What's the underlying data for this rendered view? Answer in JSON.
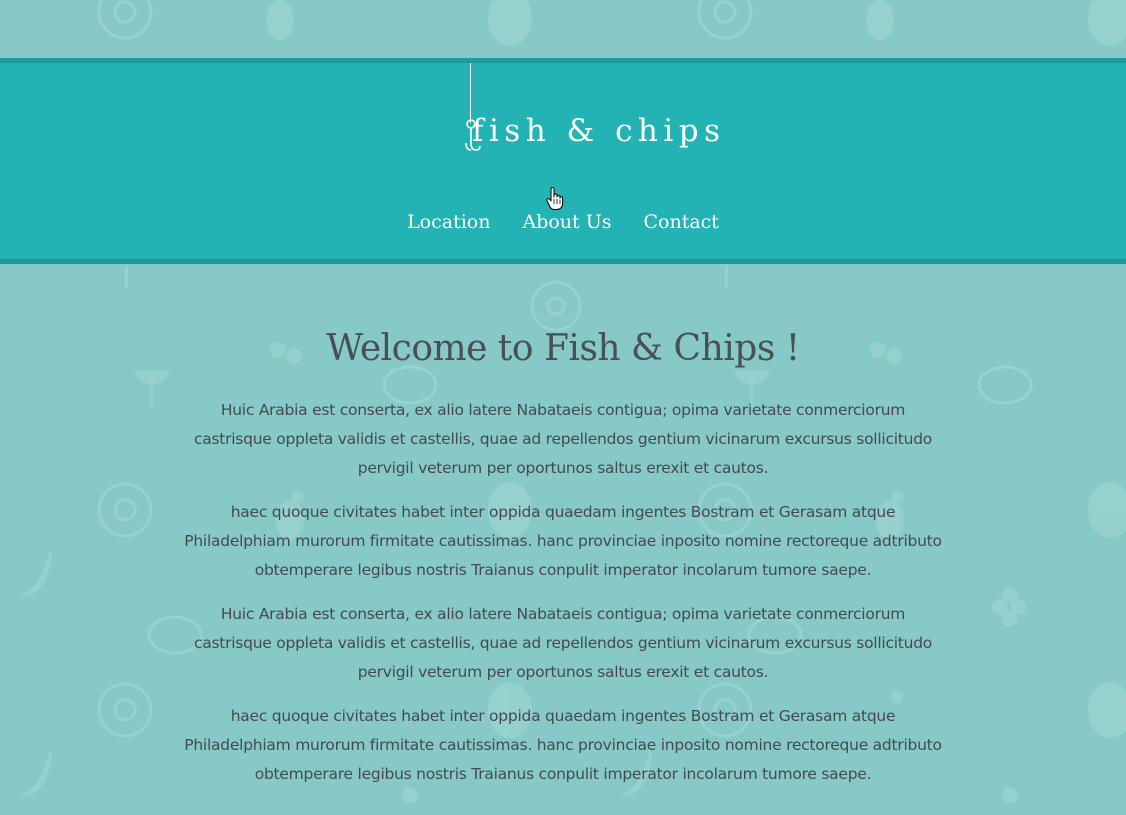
{
  "site": {
    "logo_text": "fish & chips",
    "colors": {
      "background": "#86c9c6",
      "header": "#24b3b4",
      "header_border": "#1c9a9e",
      "text": "#454a50"
    }
  },
  "nav": {
    "items": [
      {
        "label": "Location"
      },
      {
        "label": "About Us"
      },
      {
        "label": "Contact"
      }
    ]
  },
  "main": {
    "title": "Welcome to Fish & Chips !",
    "paragraphs": [
      "Huic Arabia est conserta, ex alio latere Nabataeis contigua; opima varietate conmerciorum castrisque oppleta validis et castellis, quae ad repellendos gentium vicinarum excursus sollicitudo pervigil veterum per oportunos saltus erexit et cautos.",
      "haec quoque civitates habet inter oppida quaedam ingentes Bostram et Gerasam atque Philadelphiam murorum firmitate cautissimas. hanc provinciae inposito nomine rectoreque adtributo obtemperare legibus nostris Traianus conpulit imperator incolarum tumore saepe.",
      "Huic Arabia est conserta, ex alio latere Nabataeis contigua; opima varietate conmerciorum castrisque oppleta validis et castellis, quae ad repellendos gentium vicinarum excursus sollicitudo pervigil veterum per oportunos saltus erexit et cautos.",
      "haec quoque civitates habet inter oppida quaedam ingentes Bostram et Gerasam atque Philadelphiam murorum firmitate cautissimas. hanc provinciae inposito nomine rectoreque adtributo obtemperare legibus nostris Traianus conpulit imperator incolarum tumore saepe."
    ]
  },
  "icons": {
    "background_pattern": [
      "donut-icon",
      "pineapple-icon",
      "watermelon-icon",
      "cherry-icon",
      "grill-icon",
      "banana-icon",
      "grapes-icon",
      "steak-icon",
      "palm-icon",
      "orange-icon"
    ],
    "logo": "fishhook-icon",
    "cursor": "hand-pointer-icon"
  }
}
